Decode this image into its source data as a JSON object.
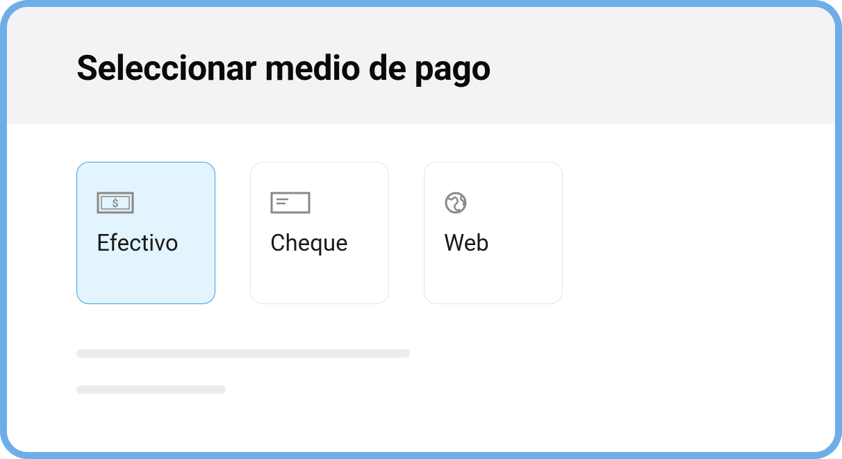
{
  "header": {
    "title": "Seleccionar medio de pago"
  },
  "payment_methods": [
    {
      "id": "cash",
      "label": "Efectivo",
      "icon": "cash-icon",
      "selected": true
    },
    {
      "id": "check",
      "label": "Cheque",
      "icon": "check-icon",
      "selected": false
    },
    {
      "id": "web",
      "label": "Web",
      "icon": "globe-icon",
      "selected": false
    }
  ]
}
